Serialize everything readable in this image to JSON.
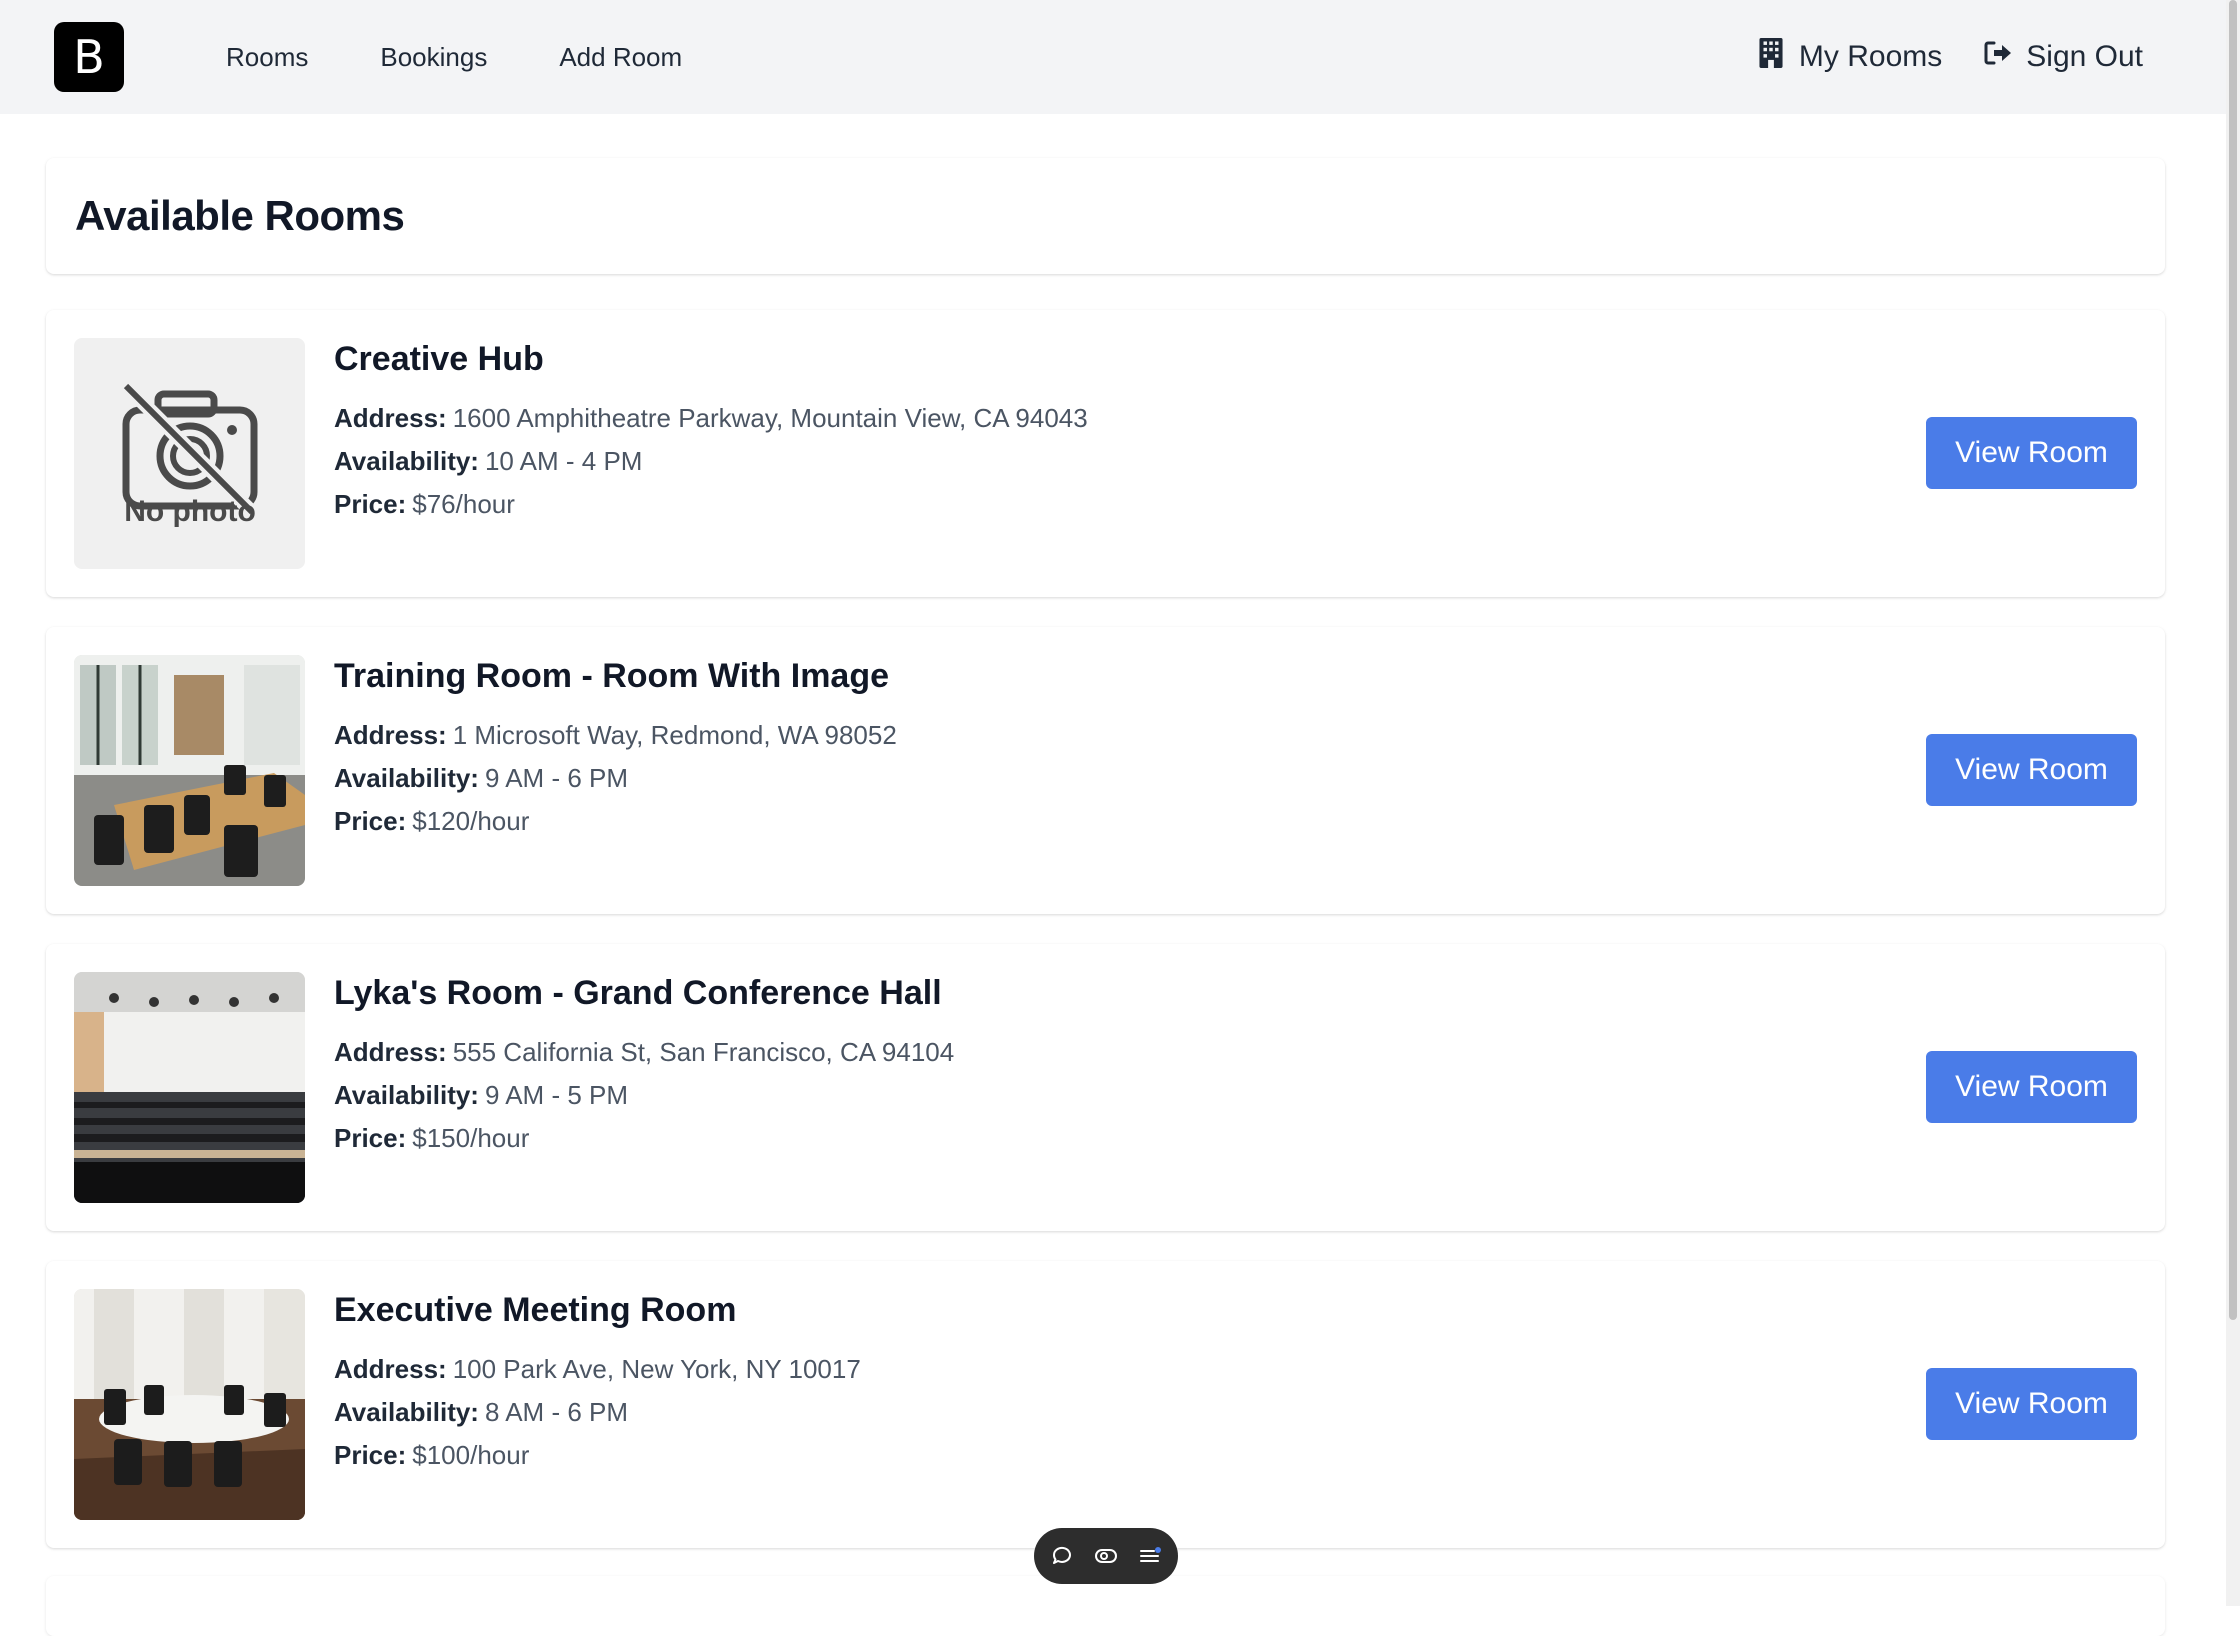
{
  "navbar": {
    "brand": "B",
    "links": [
      "Rooms",
      "Bookings",
      "Add Room"
    ],
    "my_rooms": "My Rooms",
    "sign_out": "Sign Out",
    "icons": {
      "my_rooms": "building-icon",
      "sign_out": "sign-out-icon"
    }
  },
  "page": {
    "title": "Available Rooms"
  },
  "labels": {
    "address": "Address:",
    "availability": "Availability:",
    "price": "Price:",
    "view_button": "View Room",
    "no_photo": "No photo"
  },
  "rooms": [
    {
      "name": "Creative Hub",
      "address": "1600 Amphitheatre Parkway, Mountain View, CA 94043",
      "availability": "10 AM - 4 PM",
      "price": "$76/hour",
      "image": "no-photo"
    },
    {
      "name": "Training Room - Room With Image",
      "address": "1 Microsoft Way, Redmond, WA 98052",
      "availability": "9 AM - 6 PM",
      "price": "$120/hour",
      "image": "training-room-photo"
    },
    {
      "name": "Lyka's Room - Grand Conference Hall",
      "address": "555 California St, San Francisco, CA 94104",
      "availability": "9 AM - 5 PM",
      "price": "$150/hour",
      "image": "conference-hall-photo"
    },
    {
      "name": "Executive Meeting Room",
      "address": "100 Park Ave, New York, NY 10017",
      "availability": "8 AM - 6 PM",
      "price": "$100/hour",
      "image": "executive-room-photo"
    }
  ],
  "colors": {
    "navbar_bg": "#f3f4f6",
    "button_primary": "#4a7ce8",
    "toolbar_bg": "#2d2d2d"
  },
  "toolbar": {
    "icons": [
      "comment-icon",
      "eye-icon",
      "list-icon"
    ]
  }
}
